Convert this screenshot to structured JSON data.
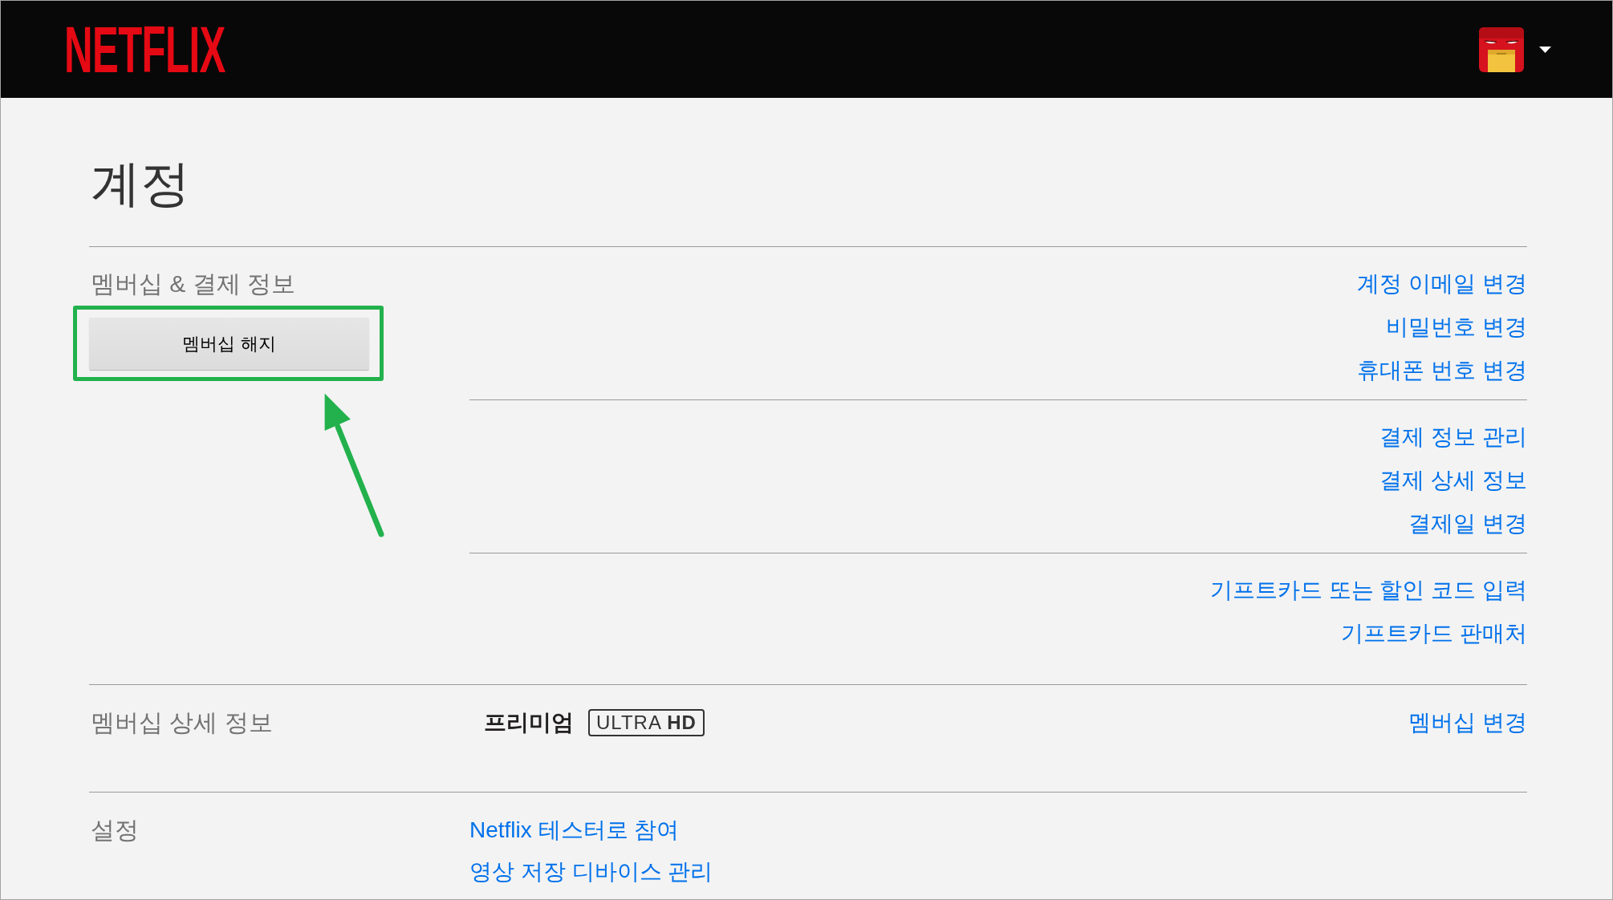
{
  "header": {
    "logo": "NETFLIX"
  },
  "page_title": "계정",
  "sections": [
    {
      "kind": "billing",
      "label": "멤버십 & 결제 정보",
      "button": {
        "label": "멤버십 해지",
        "highlighted": true
      },
      "link_groups": [
        {
          "links": [
            "계정 이메일 변경",
            "비밀번호 변경",
            "휴대폰 번호 변경"
          ]
        },
        {
          "links": [
            "결제 정보 관리",
            "결제 상세 정보",
            "결제일 변경"
          ]
        },
        {
          "links": [
            "기프트카드 또는 할인 코드 입력",
            "기프트카드 판매처"
          ]
        }
      ]
    },
    {
      "kind": "plan",
      "label": "멤버십 상세 정보",
      "plan": {
        "name": "프리미엄",
        "badge": "ULTRA **HD**"
      },
      "links": [
        "멤버십 변경"
      ]
    },
    {
      "kind": "settings",
      "label": "설정",
      "links": [
        "Netflix 테스터로 참여",
        "영상 저장 디바이스 관리"
      ]
    }
  ]
}
